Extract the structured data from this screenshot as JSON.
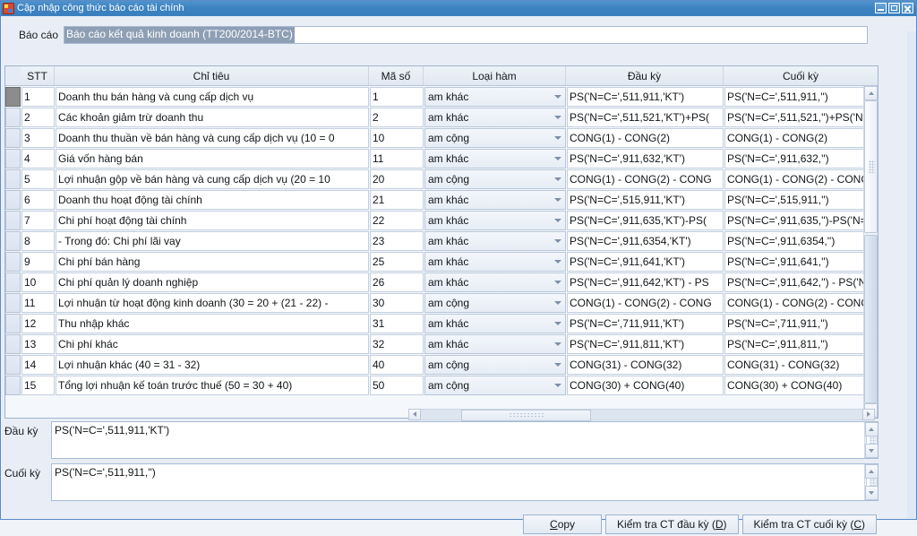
{
  "window": {
    "title": "Cập nhập công thức báo cáo tài chính",
    "icon": "app-icon",
    "minimize_label": "",
    "maximize_label": "",
    "close_label": ""
  },
  "report": {
    "label": "Báo cáo",
    "value": "Báo cáo kết quả kinh doanh (TT200/2014-BTC)",
    "selected": true
  },
  "grid": {
    "columns": [
      "STT",
      "Chỉ tiêu",
      "Mã số",
      "Loại hàm",
      "Đầu kỳ",
      "Cuối kỳ"
    ],
    "rows": [
      {
        "stt": "1",
        "chi_tieu": "Doanh thu bán hàng và cung cấp dịch vụ",
        "ma_so": "1",
        "loai_ham": "am khác",
        "dau_ky": "PS('N=C=',511,911,'KT')",
        "cuoi_ky": "PS('N=C=',511,911,'')",
        "selected": true
      },
      {
        "stt": "2",
        "chi_tieu": "Các khoản giảm trừ doanh thu",
        "ma_so": "2",
        "loai_ham": "am khác",
        "dau_ky": "PS('N=C=',511,521,'KT')+PS(",
        "cuoi_ky": "PS('N=C=',511,521,'')+PS('N",
        "selected": false
      },
      {
        "stt": "3",
        "chi_tieu": "Doanh thu thuần về bán hàng và cung cấp dịch vụ (10 = 0",
        "ma_so": "10",
        "loai_ham": "am cộng",
        "dau_ky": "CONG(1) - CONG(2)",
        "cuoi_ky": "CONG(1) - CONG(2)",
        "selected": false
      },
      {
        "stt": "4",
        "chi_tieu": "Giá vốn hàng bán",
        "ma_so": "11",
        "loai_ham": "am khác",
        "dau_ky": "PS('N=C=',911,632,'KT')",
        "cuoi_ky": "PS('N=C=',911,632,'')",
        "selected": false
      },
      {
        "stt": "5",
        "chi_tieu": "Lợi nhuận gộp về bán hàng và cung cấp dịch vụ (20 = 10",
        "ma_so": "20",
        "loai_ham": "am cộng",
        "dau_ky": "CONG(1) - CONG(2) - CONG",
        "cuoi_ky": "CONG(1) - CONG(2) - CONG",
        "selected": false
      },
      {
        "stt": "6",
        "chi_tieu": "Doanh thu hoạt động tài chính",
        "ma_so": "21",
        "loai_ham": "am khác",
        "dau_ky": "PS('N=C=',515,911,'KT')",
        "cuoi_ky": "PS('N=C=',515,911,'')",
        "selected": false
      },
      {
        "stt": "7",
        "chi_tieu": "Chi phí hoạt động tài chính",
        "ma_so": "22",
        "loai_ham": "am khác",
        "dau_ky": "PS('N=C=',911,635,'KT')-PS(",
        "cuoi_ky": "PS('N=C=',911,635,'')-PS('N=",
        "selected": false
      },
      {
        "stt": "8",
        "chi_tieu": "- Trong đó: Chi phí lãi vay",
        "ma_so": "23",
        "loai_ham": "am khác",
        "dau_ky": "PS('N=C=',911,6354,'KT')",
        "cuoi_ky": "PS('N=C=',911,6354,'')",
        "selected": false
      },
      {
        "stt": "9",
        "chi_tieu": "Chi phí bán hàng",
        "ma_so": "25",
        "loai_ham": "am khác",
        "dau_ky": "PS('N=C=',911,641,'KT')",
        "cuoi_ky": "PS('N=C=',911,641,'')",
        "selected": false
      },
      {
        "stt": "10",
        "chi_tieu": "Chi phí quản lý doanh nghiệp",
        "ma_so": "26",
        "loai_ham": "am khác",
        "dau_ky": "PS('N=C=',911,642,'KT') - PS",
        "cuoi_ky": "PS('N=C=',911,642,'') - PS('N",
        "selected": false
      },
      {
        "stt": "11",
        "chi_tieu": "Lợi nhuận từ hoạt động kinh doanh (30 = 20 + (21 - 22) -",
        "ma_so": "30",
        "loai_ham": "am cộng",
        "dau_ky": "CONG(1) - CONG(2) - CONG",
        "cuoi_ky": "CONG(1) - CONG(2) - CONG",
        "selected": false
      },
      {
        "stt": "12",
        "chi_tieu": "Thu nhập khác",
        "ma_so": "31",
        "loai_ham": "am khác",
        "dau_ky": "PS('N=C=',711,911,'KT')",
        "cuoi_ky": "PS('N=C=',711,911,'')",
        "selected": false
      },
      {
        "stt": "13",
        "chi_tieu": "Chi phí khác",
        "ma_so": "32",
        "loai_ham": "am khác",
        "dau_ky": "PS('N=C=',911,811,'KT')",
        "cuoi_ky": "PS('N=C=',911,811,'')",
        "selected": false
      },
      {
        "stt": "14",
        "chi_tieu": "Lợi nhuận khác (40 = 31 - 32)",
        "ma_so": "40",
        "loai_ham": "am cộng",
        "dau_ky": "CONG(31) - CONG(32)",
        "cuoi_ky": "CONG(31) - CONG(32)",
        "selected": false
      },
      {
        "stt": "15",
        "chi_tieu": "Tổng lợi nhuận kế toán trước thuế (50 = 30 + 40)",
        "ma_so": "50",
        "loai_ham": "am cộng",
        "dau_ky": "CONG(30) + CONG(40)",
        "cuoi_ky": "CONG(30) + CONG(40)",
        "selected": false
      }
    ]
  },
  "formula_panel": {
    "dau_ky_label": "Đầu kỳ",
    "dau_ky_value": "PS('N=C=',511,911,'KT')",
    "cuoi_ky_label": "Cuối kỳ",
    "cuoi_ky_value": "PS('N=C=',511,911,'')"
  },
  "buttons": {
    "copy": "Copy",
    "copy_mnemonic": "C",
    "check_dau_ky": "Kiểm tra CT đầu kỳ (D)",
    "check_cuoi_ky": "Kiểm tra CT cuối kỳ (C)"
  },
  "colors": {
    "titlebar": "#3c82c0",
    "window_bg": "#dfe8f4",
    "selection": "#8e9fb5",
    "grid_border": "#c4d0e0",
    "row_handle_active": "#8c8c8c"
  }
}
